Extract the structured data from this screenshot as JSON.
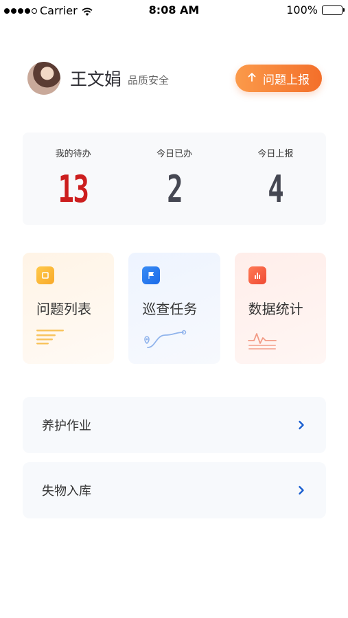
{
  "status_bar": {
    "carrier": "Carrier",
    "time": "8:08 AM",
    "battery": "100%"
  },
  "header": {
    "user_name": "王文娟",
    "user_role": "品质安全",
    "report_button_label": "问题上报"
  },
  "stats": [
    {
      "label": "我的待办",
      "value": "13",
      "color": "#cc1e1e"
    },
    {
      "label": "今日已办",
      "value": "2",
      "color": "#454752"
    },
    {
      "label": "今日上报",
      "value": "4",
      "color": "#454752"
    }
  ],
  "modules": [
    {
      "title": "问题列表",
      "icon": "document-icon",
      "accent": "#f8a92a"
    },
    {
      "title": "巡查任务",
      "icon": "flag-icon",
      "accent": "#1a6ae8"
    },
    {
      "title": "数据统计",
      "icon": "bar-chart-icon",
      "accent": "#ef4a34"
    }
  ],
  "list_items": [
    {
      "label": "养护作业",
      "icon": "chevron-right-icon"
    },
    {
      "label": "失物入库",
      "icon": "chevron-right-icon"
    }
  ]
}
